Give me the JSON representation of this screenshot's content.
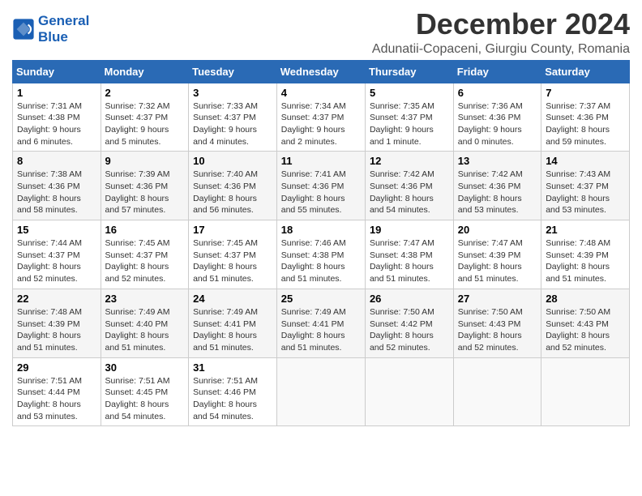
{
  "header": {
    "logo_line1": "General",
    "logo_line2": "Blue",
    "title": "December 2024",
    "subtitle": "Adunatii-Copaceni, Giurgiu County, Romania"
  },
  "days_of_week": [
    "Sunday",
    "Monday",
    "Tuesday",
    "Wednesday",
    "Thursday",
    "Friday",
    "Saturday"
  ],
  "weeks": [
    [
      {
        "day": "1",
        "sunrise": "7:31 AM",
        "sunset": "4:38 PM",
        "daylight": "9 hours and 6 minutes."
      },
      {
        "day": "2",
        "sunrise": "7:32 AM",
        "sunset": "4:37 PM",
        "daylight": "9 hours and 5 minutes."
      },
      {
        "day": "3",
        "sunrise": "7:33 AM",
        "sunset": "4:37 PM",
        "daylight": "9 hours and 4 minutes."
      },
      {
        "day": "4",
        "sunrise": "7:34 AM",
        "sunset": "4:37 PM",
        "daylight": "9 hours and 2 minutes."
      },
      {
        "day": "5",
        "sunrise": "7:35 AM",
        "sunset": "4:37 PM",
        "daylight": "9 hours and 1 minute."
      },
      {
        "day": "6",
        "sunrise": "7:36 AM",
        "sunset": "4:36 PM",
        "daylight": "9 hours and 0 minutes."
      },
      {
        "day": "7",
        "sunrise": "7:37 AM",
        "sunset": "4:36 PM",
        "daylight": "8 hours and 59 minutes."
      }
    ],
    [
      {
        "day": "8",
        "sunrise": "7:38 AM",
        "sunset": "4:36 PM",
        "daylight": "8 hours and 58 minutes."
      },
      {
        "day": "9",
        "sunrise": "7:39 AM",
        "sunset": "4:36 PM",
        "daylight": "8 hours and 57 minutes."
      },
      {
        "day": "10",
        "sunrise": "7:40 AM",
        "sunset": "4:36 PM",
        "daylight": "8 hours and 56 minutes."
      },
      {
        "day": "11",
        "sunrise": "7:41 AM",
        "sunset": "4:36 PM",
        "daylight": "8 hours and 55 minutes."
      },
      {
        "day": "12",
        "sunrise": "7:42 AM",
        "sunset": "4:36 PM",
        "daylight": "8 hours and 54 minutes."
      },
      {
        "day": "13",
        "sunrise": "7:42 AM",
        "sunset": "4:36 PM",
        "daylight": "8 hours and 53 minutes."
      },
      {
        "day": "14",
        "sunrise": "7:43 AM",
        "sunset": "4:37 PM",
        "daylight": "8 hours and 53 minutes."
      }
    ],
    [
      {
        "day": "15",
        "sunrise": "7:44 AM",
        "sunset": "4:37 PM",
        "daylight": "8 hours and 52 minutes."
      },
      {
        "day": "16",
        "sunrise": "7:45 AM",
        "sunset": "4:37 PM",
        "daylight": "8 hours and 52 minutes."
      },
      {
        "day": "17",
        "sunrise": "7:45 AM",
        "sunset": "4:37 PM",
        "daylight": "8 hours and 51 minutes."
      },
      {
        "day": "18",
        "sunrise": "7:46 AM",
        "sunset": "4:38 PM",
        "daylight": "8 hours and 51 minutes."
      },
      {
        "day": "19",
        "sunrise": "7:47 AM",
        "sunset": "4:38 PM",
        "daylight": "8 hours and 51 minutes."
      },
      {
        "day": "20",
        "sunrise": "7:47 AM",
        "sunset": "4:39 PM",
        "daylight": "8 hours and 51 minutes."
      },
      {
        "day": "21",
        "sunrise": "7:48 AM",
        "sunset": "4:39 PM",
        "daylight": "8 hours and 51 minutes."
      }
    ],
    [
      {
        "day": "22",
        "sunrise": "7:48 AM",
        "sunset": "4:39 PM",
        "daylight": "8 hours and 51 minutes."
      },
      {
        "day": "23",
        "sunrise": "7:49 AM",
        "sunset": "4:40 PM",
        "daylight": "8 hours and 51 minutes."
      },
      {
        "day": "24",
        "sunrise": "7:49 AM",
        "sunset": "4:41 PM",
        "daylight": "8 hours and 51 minutes."
      },
      {
        "day": "25",
        "sunrise": "7:49 AM",
        "sunset": "4:41 PM",
        "daylight": "8 hours and 51 minutes."
      },
      {
        "day": "26",
        "sunrise": "7:50 AM",
        "sunset": "4:42 PM",
        "daylight": "8 hours and 52 minutes."
      },
      {
        "day": "27",
        "sunrise": "7:50 AM",
        "sunset": "4:43 PM",
        "daylight": "8 hours and 52 minutes."
      },
      {
        "day": "28",
        "sunrise": "7:50 AM",
        "sunset": "4:43 PM",
        "daylight": "8 hours and 52 minutes."
      }
    ],
    [
      {
        "day": "29",
        "sunrise": "7:51 AM",
        "sunset": "4:44 PM",
        "daylight": "8 hours and 53 minutes."
      },
      {
        "day": "30",
        "sunrise": "7:51 AM",
        "sunset": "4:45 PM",
        "daylight": "8 hours and 54 minutes."
      },
      {
        "day": "31",
        "sunrise": "7:51 AM",
        "sunset": "4:46 PM",
        "daylight": "8 hours and 54 minutes."
      },
      null,
      null,
      null,
      null
    ]
  ],
  "labels": {
    "sunrise": "Sunrise:",
    "sunset": "Sunset:",
    "daylight": "Daylight:"
  }
}
